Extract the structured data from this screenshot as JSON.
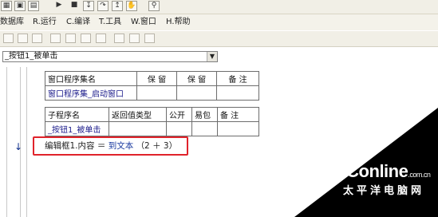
{
  "toolbar": {
    "buttons": [
      {
        "icon": "grid-icon",
        "glyph": "▦"
      },
      {
        "icon": "window-icon",
        "glyph": "▣"
      },
      {
        "icon": "panel-icon",
        "glyph": "▤"
      },
      {
        "icon": "run-icon",
        "glyph": "▶"
      },
      {
        "icon": "stop-icon",
        "glyph": "■"
      },
      {
        "icon": "step-into-icon",
        "glyph": "↧"
      },
      {
        "icon": "step-over-icon",
        "glyph": "↷"
      },
      {
        "icon": "step-out-icon",
        "glyph": "↥"
      },
      {
        "icon": "hand-icon",
        "glyph": "✋"
      },
      {
        "icon": "binoculars-icon",
        "glyph": "⚲"
      }
    ]
  },
  "menubar": {
    "items": [
      {
        "label": "数据库"
      },
      {
        "label": "R.运行"
      },
      {
        "label": "C.编译"
      },
      {
        "label": "T.工具"
      },
      {
        "label": "W.窗口"
      },
      {
        "label": "H.帮助"
      }
    ]
  },
  "subroutine_selector": {
    "value": "_按钮1_被单击"
  },
  "assembly_table": {
    "headers": [
      "窗口程序集名",
      "保 留",
      "保 留",
      "备 注"
    ],
    "row": [
      "窗口程序集_启动窗口",
      "",
      "",
      ""
    ]
  },
  "subroutine_table": {
    "headers": [
      "子程序名",
      "返回值类型",
      "公开",
      "易包",
      "备 注"
    ],
    "row": [
      "_按钮1_被单击",
      "",
      "",
      "",
      ""
    ]
  },
  "code_line": {
    "target": "编辑框1.内容",
    "operator": "＝",
    "function": "到文本",
    "args": "（2 ＋ 3）"
  },
  "watermark": {
    "logo": "PConline",
    "suffix": ".com.cn",
    "subtitle": "太平洋电脑网"
  },
  "colors": {
    "highlight": "#e0232b",
    "identifier": "#1a1a8a"
  }
}
